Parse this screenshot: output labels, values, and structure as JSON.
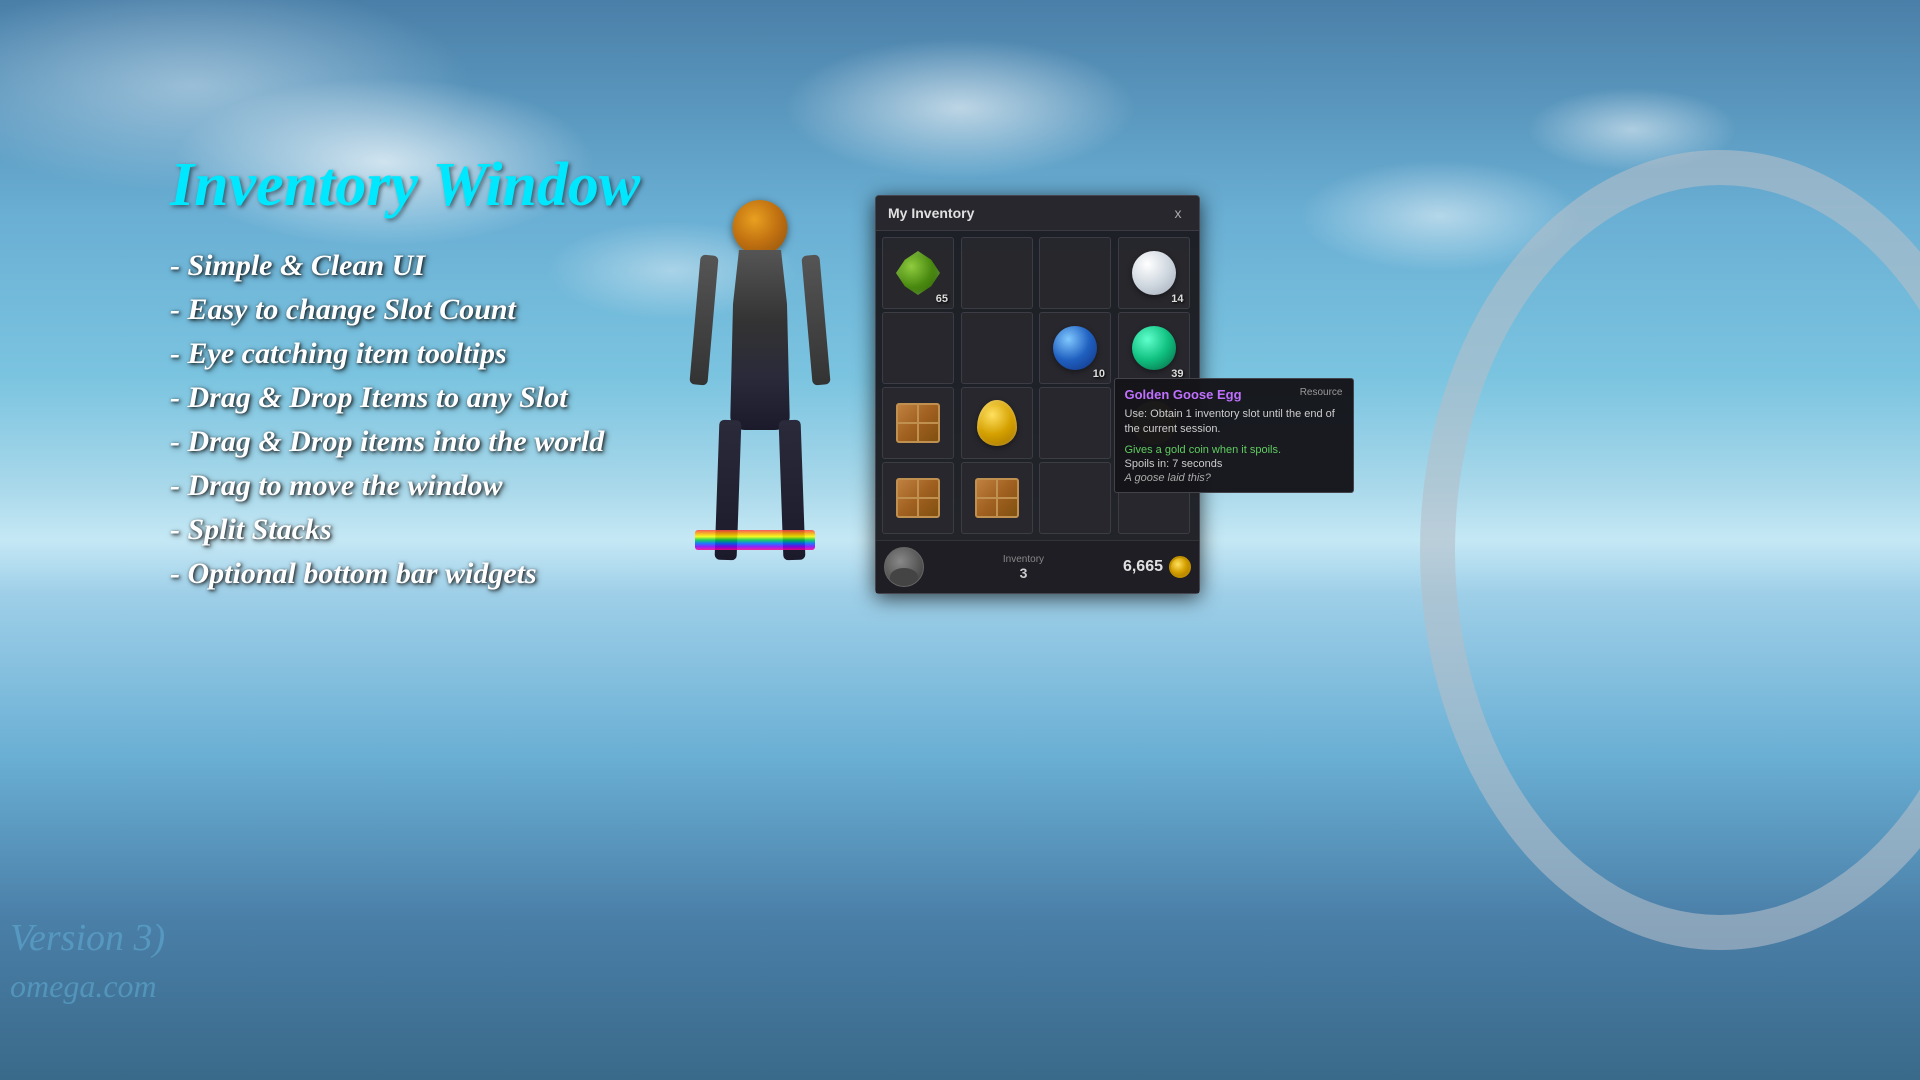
{
  "background": {
    "description": "Sky and ocean background with clouds"
  },
  "title": "Inventory Window",
  "features": [
    "- Simple & Clean UI",
    "- Easy to change Slot Count",
    "- Eye catching item tooltips",
    "- Drag & Drop Items to any Slot",
    "- Drag & Drop items into the world",
    "- Drag to move the window",
    "- Split Stacks",
    "- Optional bottom bar widgets"
  ],
  "version_text": "Version 3)",
  "website_text": "omega.com",
  "inventory_window": {
    "title": "My Inventory",
    "close_button": "x",
    "slots": [
      {
        "id": 0,
        "has_item": true,
        "item_type": "gem",
        "count": 65
      },
      {
        "id": 1,
        "has_item": false
      },
      {
        "id": 2,
        "has_item": false
      },
      {
        "id": 3,
        "has_item": true,
        "item_type": "white_sphere",
        "count": 14
      },
      {
        "id": 4,
        "has_item": false
      },
      {
        "id": 5,
        "has_item": false
      },
      {
        "id": 6,
        "has_item": false
      },
      {
        "id": 7,
        "has_item": true,
        "item_type": "blue_sphere",
        "count": 10
      },
      {
        "id": 8,
        "has_item": true,
        "item_type": "teal_sphere",
        "count": 39
      },
      {
        "id": 9,
        "has_item": true,
        "item_type": "crate",
        "count": null
      },
      {
        "id": 10,
        "has_item": true,
        "item_type": "gold_egg",
        "count": null
      },
      {
        "id": 11,
        "has_item": false
      },
      {
        "id": 12,
        "has_item": true,
        "item_type": "yellow_sphere",
        "count": null
      },
      {
        "id": 13,
        "has_item": true,
        "item_type": "crate_small",
        "count": null
      },
      {
        "id": 14,
        "has_item": true,
        "item_type": "crate_small2",
        "count": null
      },
      {
        "id": 15,
        "has_item": false
      }
    ],
    "tooltip": {
      "item_name": "Golden Goose Egg",
      "item_type": "Resource",
      "description": "Use: Obtain 1 inventory slot until the end of the current session.",
      "gold_line": "Gives a gold coin when it spoils.",
      "spoil_line": "Spoils in: 7 seconds",
      "flavor_line": "A goose laid this?"
    },
    "bottom_bar": {
      "slot_label": "Inventory",
      "slot_count": 3,
      "currency": "6,665"
    }
  }
}
